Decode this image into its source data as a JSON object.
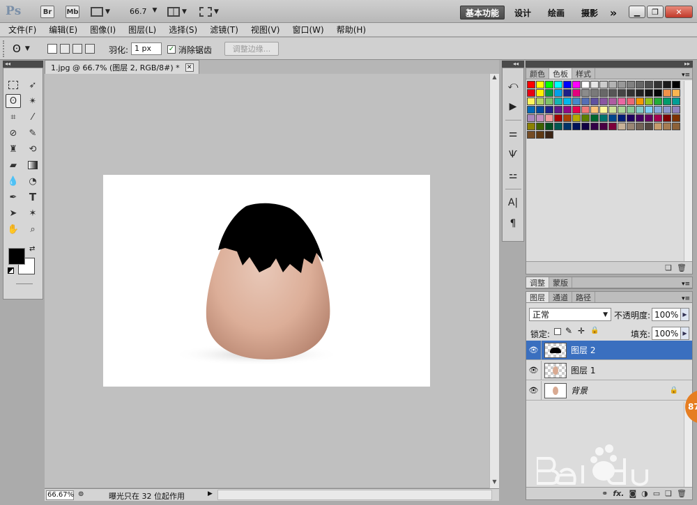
{
  "app": {
    "logo": "Ps",
    "bridge_label": "Br",
    "minibridge_label": "Mb",
    "zoom_value": "66.7",
    "workspaces": [
      "基本功能",
      "设计",
      "绘画",
      "摄影"
    ],
    "overflow_label": "»"
  },
  "menu": [
    "文件(F)",
    "编辑(E)",
    "图像(I)",
    "图层(L)",
    "选择(S)",
    "滤镜(T)",
    "视图(V)",
    "窗口(W)",
    "帮助(H)"
  ],
  "options": {
    "feather_label": "羽化:",
    "feather_value": "1 px",
    "antialias_label": "消除锯齿",
    "antialias_checked": true,
    "refine_edge_label": "调整边缘..."
  },
  "document": {
    "tab_title": "1.jpg @ 66.7% (图层 2, RGB/8#) *",
    "zoom_status": "66.67%",
    "status_text": "曝光只在 32 位起作用"
  },
  "panels": {
    "color_tabs": [
      "颜色",
      "色板",
      "样式"
    ],
    "active_color_tab": "色板",
    "adjust_tabs": [
      "调整",
      "蒙版"
    ],
    "layer_tabs": [
      "图层",
      "通道",
      "路径"
    ],
    "blend_mode": "正常",
    "opacity_label": "不透明度:",
    "opacity_value": "100%",
    "lock_label": "锁定:",
    "fill_label": "填充:",
    "fill_value": "100%"
  },
  "layers": [
    {
      "name": "图层 2",
      "selected": true
    },
    {
      "name": "图层 1",
      "selected": false
    },
    {
      "name": "背景",
      "selected": false,
      "locked": true
    }
  ],
  "swatch_colors": [
    "#ff0000",
    "#ffff00",
    "#00ff00",
    "#00ffff",
    "#0000ff",
    "#ff00ff",
    "#ffffff",
    "#e6e6e6",
    "#cccccc",
    "#b3b3b3",
    "#999999",
    "#808080",
    "#666666",
    "#4d4d4d",
    "#333333",
    "#1a1a1a",
    "#000000",
    "#e60012",
    "#fff100",
    "#009944",
    "#00a0e9",
    "#1d2088",
    "#e4007f",
    "#8c8c8c",
    "#7a7a7a",
    "#686868",
    "#565656",
    "#444444",
    "#323232",
    "#202020",
    "#111111",
    "#050505",
    "#f19149",
    "#f8b551",
    "#fff45c",
    "#b3d465",
    "#80c269",
    "#13b5b1",
    "#00b7ee",
    "#448aca",
    "#556fb5",
    "#5f52a0",
    "#8957a1",
    "#ae5da1",
    "#ea68a2",
    "#eb6877",
    "#f39800",
    "#8fc31f",
    "#22ac38",
    "#009b6b",
    "#009e96",
    "#0068b7",
    "#00479d",
    "#1d2088",
    "#601986",
    "#920783",
    "#e5004f",
    "#f07a7a",
    "#fbc279",
    "#fff799",
    "#cce198",
    "#acd598",
    "#89c997",
    "#84ccc9",
    "#7ecef4",
    "#88abda",
    "#8c97cb",
    "#8f82bc",
    "#aa89bd",
    "#c490bf",
    "#f29c9f",
    "#a40000",
    "#a84200",
    "#b7aa00",
    "#5b7e00",
    "#00662f",
    "#00736d",
    "#00468c",
    "#001d77",
    "#1d005f",
    "#440062",
    "#630060",
    "#a4004f",
    "#7d0000",
    "#7d3100",
    "#8c8100",
    "#3e6100",
    "#004d21",
    "#005752",
    "#003468",
    "#001259",
    "#100043",
    "#330047",
    "#4a0044",
    "#7d003b",
    "#c7b299",
    "#998675",
    "#736357",
    "#534741",
    "#c69c6d",
    "#a67c52",
    "#8c6239",
    "#754c24",
    "#603913",
    "#3c2415"
  ]
}
